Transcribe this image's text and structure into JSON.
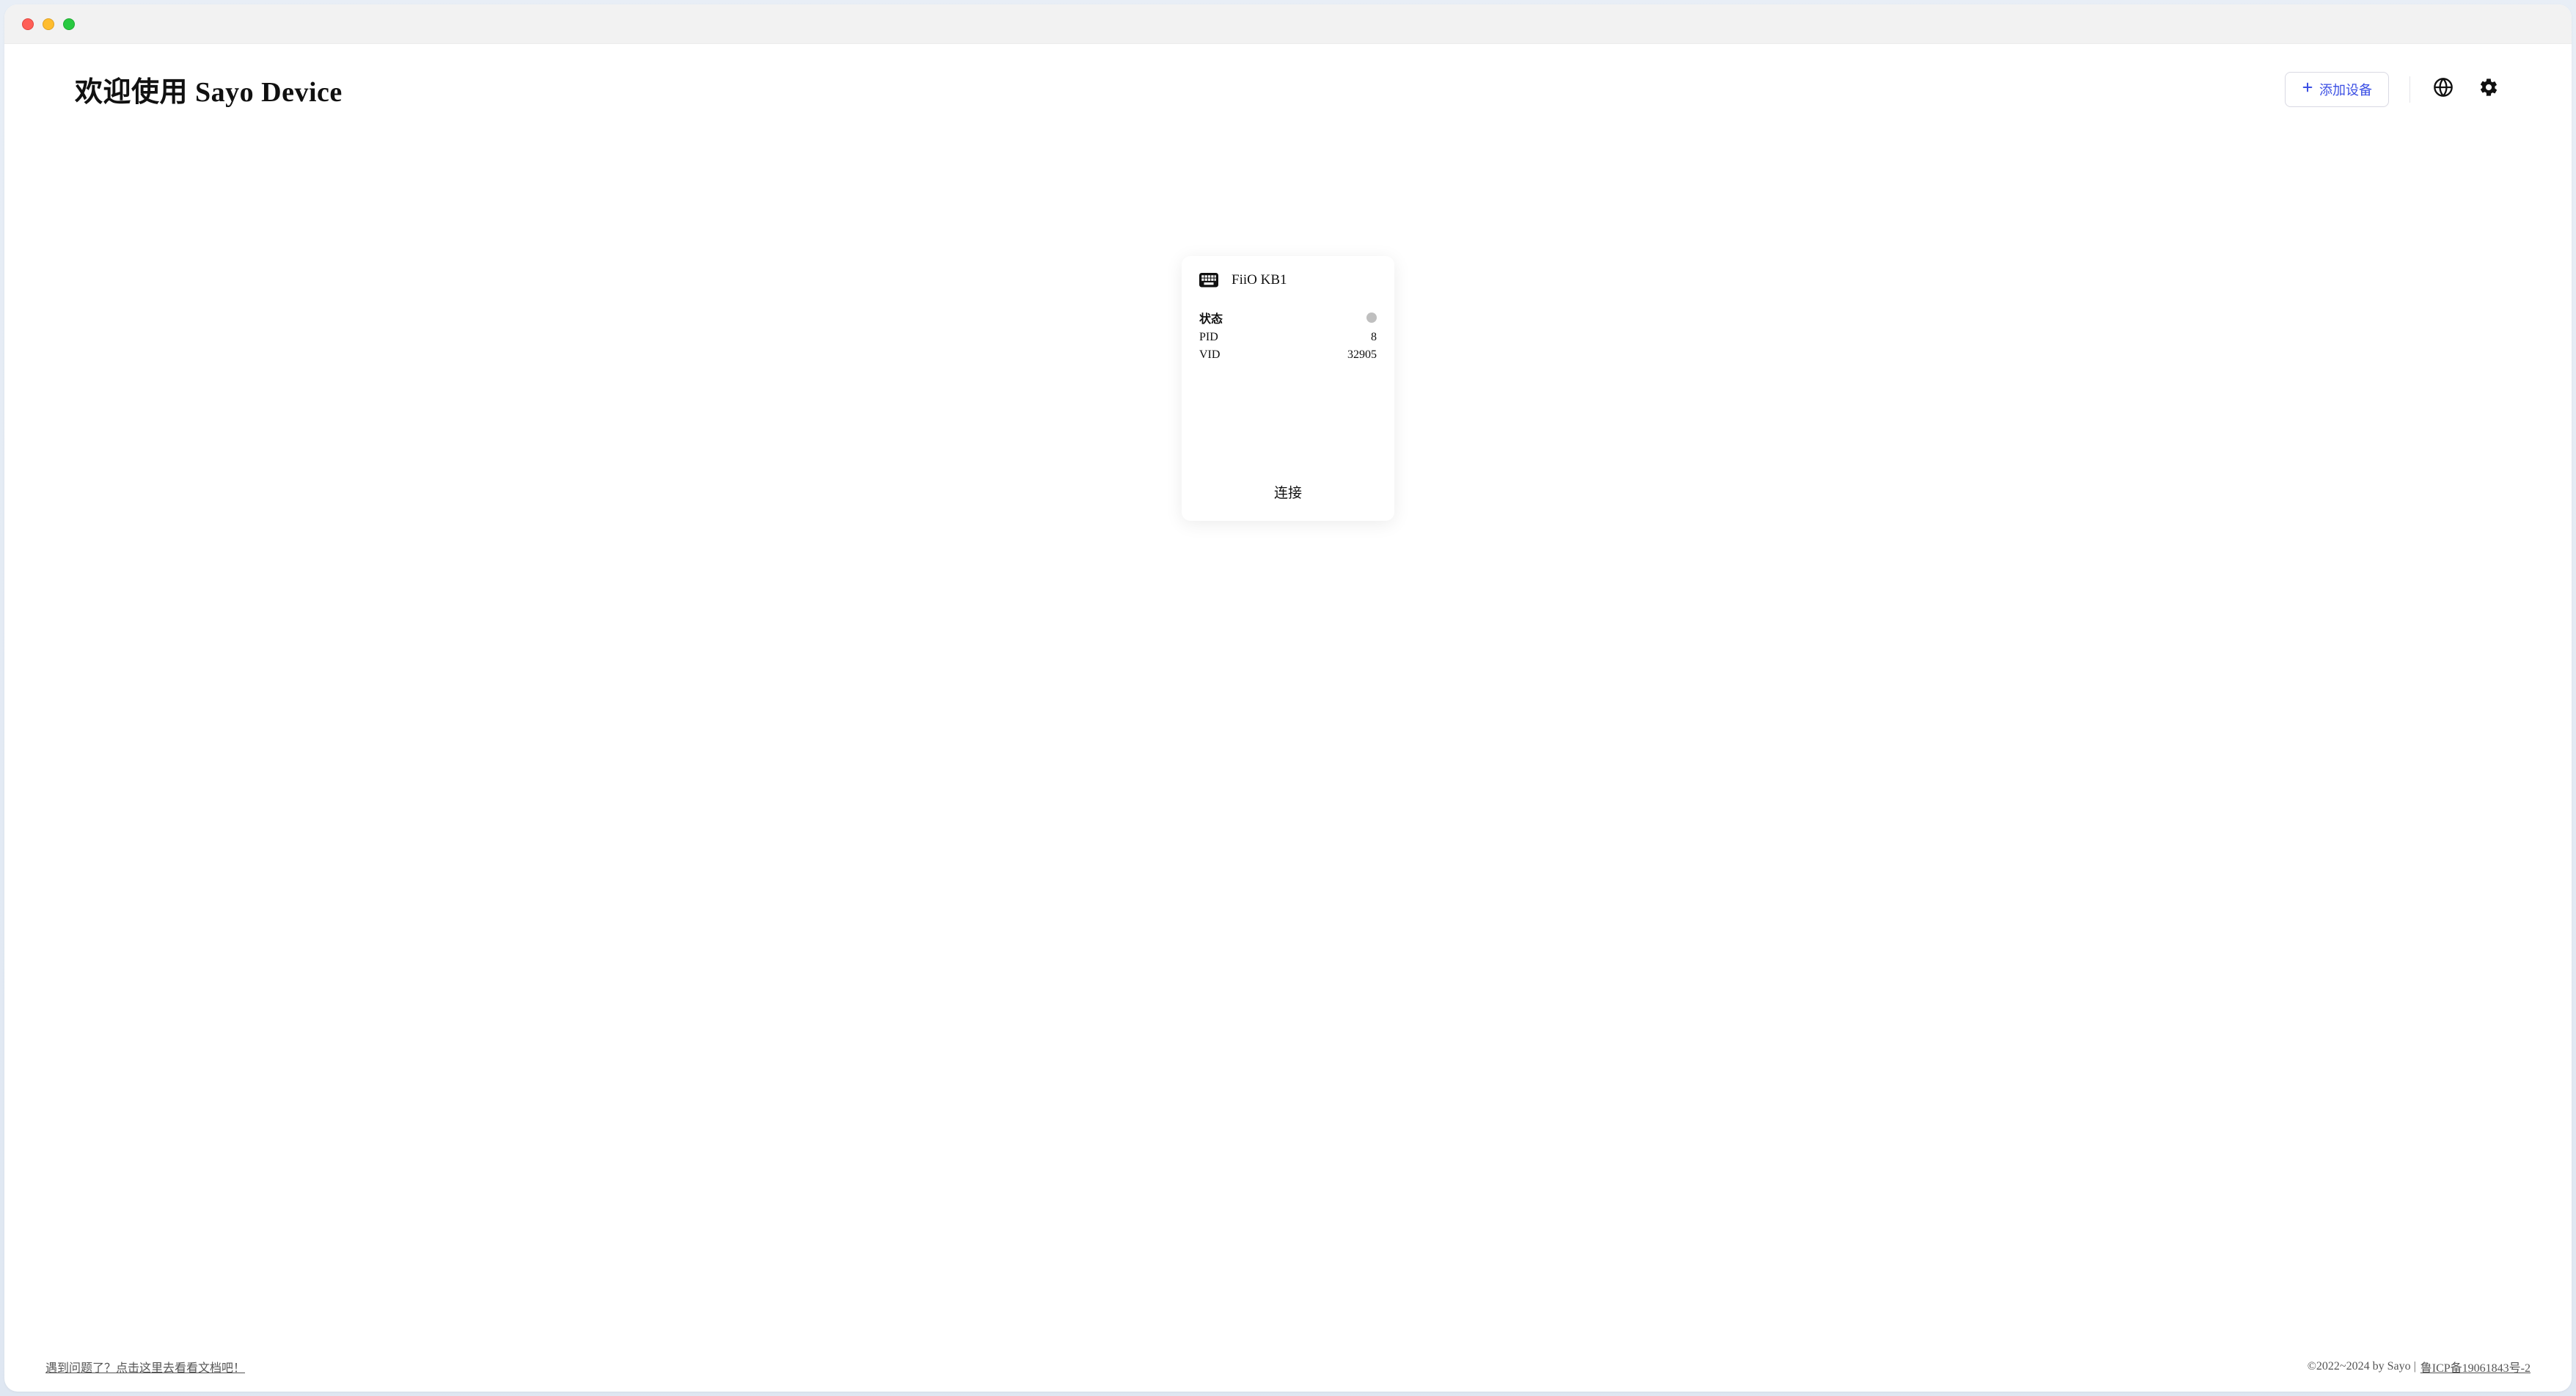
{
  "header": {
    "title": "欢迎使用 Sayo Device",
    "add_device_label": "添加设备"
  },
  "device": {
    "name": "FiiO KB1",
    "rows": {
      "status_label": "状态",
      "pid_label": "PID",
      "pid_value": "8",
      "vid_label": "VID",
      "vid_value": "32905"
    },
    "connect_label": "连接"
  },
  "footer": {
    "help_link": "遇到问题了？点击这里去看看文档吧！",
    "copyright": "©2022~2024 by Sayo | ",
    "icp": " 鲁ICP备19061843号-2"
  }
}
